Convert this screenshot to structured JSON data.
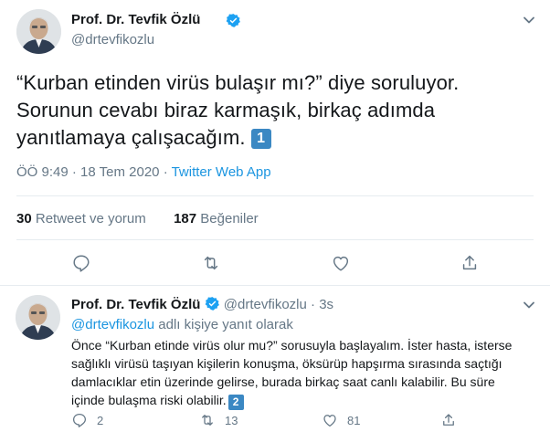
{
  "main_tweet": {
    "author_name": "Prof. Dr. Tevfik Özlü",
    "handle": "@drtevfikozlu",
    "text": "“Kurban etinden virüs bulaşır mı?” diye soruluyor. Sorunun cevabı biraz karmaşık, birkaç adımda yanıtlamaya çalışacağım.",
    "badge": "1",
    "time": "ÖÖ 9:49",
    "separator": "·",
    "date": "18 Tem 2020",
    "app": "Twitter Web App",
    "retweet_count": "30",
    "retweet_label": "Retweet ve yorum",
    "like_count": "187",
    "like_label": "Beğeniler"
  },
  "reply_tweet": {
    "author_name": "Prof. Dr. Tevfik Özlü",
    "handle": "@drtevfikozlu",
    "separator": "·",
    "age": "3s",
    "replying_mention": "@drtevfikozlu",
    "replying_suffix": "adlı kişiye yanıt olarak",
    "text": "Önce “Kurban etinde virüs olur mu?” sorusuyla başlayalım. İster hasta, isterse sağlıklı virüsü taşıyan kişilerin konuşma, öksürüp hapşırma sırasında saçtığı damlacıklar etin üzerinde gelirse, burada birkaç saat canlı kalabilir. Bu süre içinde bulaşma riski olabilir.",
    "badge": "2",
    "reply_count": "2",
    "retweet_count": "13",
    "like_count": "81"
  },
  "icons": {
    "verified": "verified-badge-icon",
    "chevron": "chevron-down-icon",
    "reply": "reply-icon",
    "retweet": "retweet-icon",
    "like": "heart-icon",
    "share": "share-icon"
  },
  "colors": {
    "accent": "#1b95e0",
    "verified": "#1da1f2",
    "muted": "#657786",
    "text": "#14171a",
    "divider": "#e6ecf0",
    "badge": "#3b88c3"
  }
}
